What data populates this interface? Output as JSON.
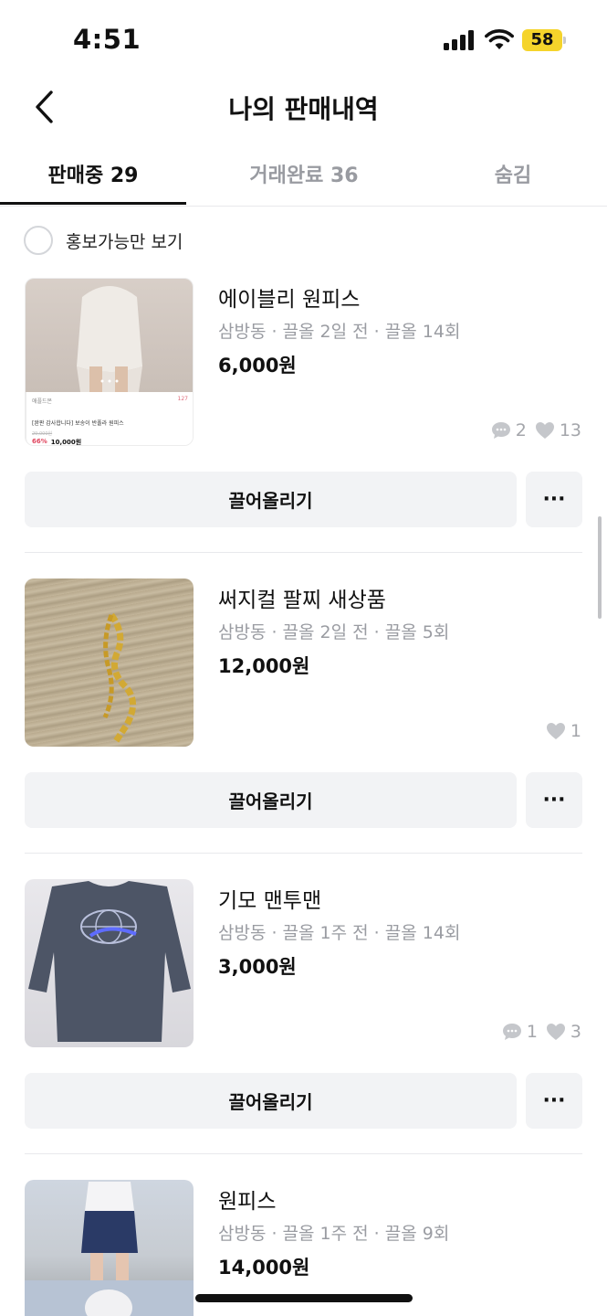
{
  "status_bar": {
    "time": "4:51",
    "battery": "58"
  },
  "header": {
    "title": "나의 판매내역"
  },
  "tabs": [
    {
      "label": "판매중 29",
      "active": true
    },
    {
      "label": "거래완료 36",
      "active": false
    },
    {
      "label": "숨김",
      "active": false
    }
  ],
  "filter": {
    "label": "홍보가능만 보기"
  },
  "thumb1": {
    "shop": "애플드몬",
    "likes": "127",
    "desc": "[완판 감사합니다] 보송이 반폴라 원피스",
    "old_price": "29,000원",
    "discount": "66%",
    "sale_price": "10,000원"
  },
  "items": [
    {
      "title": "에이블리 원피스",
      "meta": "삼방동 · 끌올 2일 전 · 끌올 14회",
      "price": "6,000원",
      "chats": "2",
      "likes": "13",
      "bump": "끌어올리기",
      "more": "···"
    },
    {
      "title": "써지컬 팔찌 새상품",
      "meta": "삼방동 · 끌올 2일 전 · 끌올 5회",
      "price": "12,000원",
      "chats": "",
      "likes": "1",
      "bump": "끌어올리기",
      "more": "···"
    },
    {
      "title": "기모 맨투맨",
      "meta": "삼방동 · 끌올 1주 전 · 끌올 14회",
      "price": "3,000원",
      "chats": "1",
      "likes": "3",
      "bump": "끌어올리기",
      "more": "···"
    },
    {
      "title": "원피스",
      "meta": "삼방동 · 끌올 1주 전 · 끌올 9회",
      "price": "14,000원"
    }
  ],
  "colors": {
    "bump_bg": "#f2f3f5",
    "meta_text": "#9a9ca2",
    "battery": "#f5d42b"
  },
  "icons": {
    "back": "chevron-left-icon",
    "chat": "chat-bubble-icon",
    "like": "heart-icon"
  }
}
